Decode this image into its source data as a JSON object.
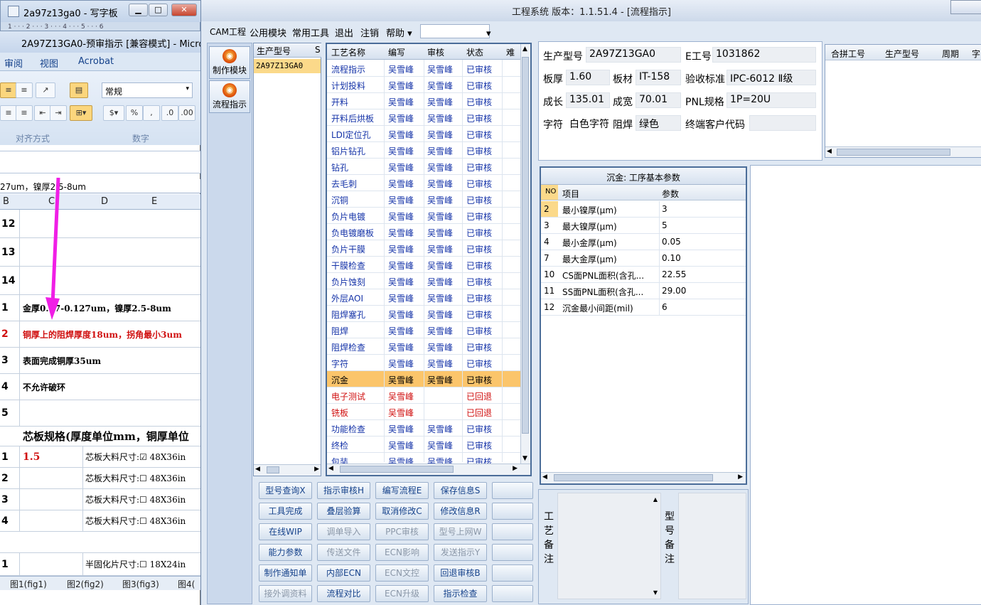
{
  "wordpad": {
    "title": "2a97z13ga0 - 写字板",
    "ruler": "1 · · · 2 · · · 3 · · · 4 · · · 5 · · · 6"
  },
  "excel": {
    "title": "2A97Z13GA0-预审指示 [兼容模式] - Microsof",
    "tabs": [
      "审阅",
      "视图",
      "Acrobat"
    ],
    "format_value": "常规",
    "group_align": "对齐方式",
    "group_number": "数字",
    "formula_text": "27um，镍厚2.5-8um",
    "col_headers": [
      "B",
      "C",
      "D",
      "E"
    ],
    "rows": [
      {
        "num": "12",
        "text": "",
        "red": false
      },
      {
        "num": "13",
        "text": "",
        "red": false
      },
      {
        "num": "14",
        "text": "",
        "red": false
      },
      {
        "num": "1",
        "text": "金厚0.07-0.127um，镍厚2.5-8um",
        "red": false
      },
      {
        "num": "2",
        "text": "铜厚上的阻焊厚度18um，拐角最小3um",
        "red": true
      },
      {
        "num": "3",
        "text": "表面完成铜厚35um",
        "red": false
      },
      {
        "num": "4",
        "text": "不允许破环",
        "red": false
      },
      {
        "num": "5",
        "text": "",
        "red": false
      }
    ],
    "core_header": "芯板规格(厚度单位mm，铜厚单位",
    "core_rows": [
      {
        "num": "1",
        "val": "1.5",
        "label": "芯板大料尺寸:☑ 48X36in"
      },
      {
        "num": "2",
        "val": "",
        "label": "芯板大料尺寸:☐ 48X36in"
      },
      {
        "num": "3",
        "val": "",
        "label": "芯板大料尺寸:☐ 48X36in"
      },
      {
        "num": "4",
        "val": "",
        "label": "芯板大料尺寸:☐ 48X36in"
      }
    ],
    "pp_row": {
      "num": "1",
      "label": "半固化片尺寸:☐ 18X24in"
    },
    "sheet_tabs": [
      "图1(fig1)",
      "图2(fig2)",
      "图3(fig3)",
      "图4("
    ]
  },
  "app": {
    "title": "工程系统  版本：1.1.51.4 - [流程指示]",
    "menu": [
      "CAM工程",
      "公用模块",
      "常用工具",
      "退出",
      "注销",
      "帮助 ▾"
    ],
    "nav": [
      {
        "label": "制作模块"
      },
      {
        "label": "流程指示"
      }
    ],
    "model_header": "生产型号",
    "model_header_more": "S",
    "model_selected": "2A97Z13GA0",
    "grid_headers": [
      "工艺名称",
      "编写",
      "审核",
      "状态",
      "难"
    ],
    "process_rows": [
      {
        "name": "流程指示",
        "writer": "吴雪峰",
        "reviewer": "吴雪峰",
        "status": "已审核",
        "state": "normal"
      },
      {
        "name": "计划投料",
        "writer": "吴雪峰",
        "reviewer": "吴雪峰",
        "status": "已审核",
        "state": "normal"
      },
      {
        "name": "开料",
        "writer": "吴雪峰",
        "reviewer": "吴雪峰",
        "status": "已审核",
        "state": "normal"
      },
      {
        "name": "开料后烘板",
        "writer": "吴雪峰",
        "reviewer": "吴雪峰",
        "status": "已审核",
        "state": "normal"
      },
      {
        "name": "LDI定位孔",
        "writer": "吴雪峰",
        "reviewer": "吴雪峰",
        "status": "已审核",
        "state": "normal"
      },
      {
        "name": "铝片钻孔",
        "writer": "吴雪峰",
        "reviewer": "吴雪峰",
        "status": "已审核",
        "state": "normal"
      },
      {
        "name": "钻孔",
        "writer": "吴雪峰",
        "reviewer": "吴雪峰",
        "status": "已审核",
        "state": "normal"
      },
      {
        "name": "去毛刺",
        "writer": "吴雪峰",
        "reviewer": "吴雪峰",
        "status": "已审核",
        "state": "normal"
      },
      {
        "name": "沉铜",
        "writer": "吴雪峰",
        "reviewer": "吴雪峰",
        "status": "已审核",
        "state": "normal"
      },
      {
        "name": "负片电镀",
        "writer": "吴雪峰",
        "reviewer": "吴雪峰",
        "status": "已审核",
        "state": "normal"
      },
      {
        "name": "负电镀磨板",
        "writer": "吴雪峰",
        "reviewer": "吴雪峰",
        "status": "已审核",
        "state": "normal"
      },
      {
        "name": "负片干膜",
        "writer": "吴雪峰",
        "reviewer": "吴雪峰",
        "status": "已审核",
        "state": "normal"
      },
      {
        "name": "干膜检查",
        "writer": "吴雪峰",
        "reviewer": "吴雪峰",
        "status": "已审核",
        "state": "normal"
      },
      {
        "name": "负片蚀刻",
        "writer": "吴雪峰",
        "reviewer": "吴雪峰",
        "status": "已审核",
        "state": "normal"
      },
      {
        "name": "外层AOI",
        "writer": "吴雪峰",
        "reviewer": "吴雪峰",
        "status": "已审核",
        "state": "normal"
      },
      {
        "name": "阻焊塞孔",
        "writer": "吴雪峰",
        "reviewer": "吴雪峰",
        "status": "已审核",
        "state": "normal"
      },
      {
        "name": "阻焊",
        "writer": "吴雪峰",
        "reviewer": "吴雪峰",
        "status": "已审核",
        "state": "normal"
      },
      {
        "name": "阻焊检查",
        "writer": "吴雪峰",
        "reviewer": "吴雪峰",
        "status": "已审核",
        "state": "normal"
      },
      {
        "name": "字符",
        "writer": "吴雪峰",
        "reviewer": "吴雪峰",
        "status": "已审核",
        "state": "normal"
      },
      {
        "name": "沉金",
        "writer": "吴雪峰",
        "reviewer": "吴雪峰",
        "status": "已审核",
        "state": "selected"
      },
      {
        "name": "电子测试",
        "writer": "吴雪峰",
        "reviewer": "",
        "status": "已回退",
        "state": "red"
      },
      {
        "name": "铣板",
        "writer": "吴雪峰",
        "reviewer": "",
        "status": "已回退",
        "state": "red"
      },
      {
        "name": "功能检查",
        "writer": "吴雪峰",
        "reviewer": "吴雪峰",
        "status": "已审核",
        "state": "normal"
      },
      {
        "name": "终检",
        "writer": "吴雪峰",
        "reviewer": "吴雪峰",
        "status": "已审核",
        "state": "normal"
      },
      {
        "name": "包装",
        "writer": "吴雪峰",
        "reviewer": "吴雪峰",
        "status": "已审核",
        "state": "normal"
      }
    ],
    "buttons": [
      [
        {
          "label": "型号查询X",
          "enabled": true
        },
        {
          "label": "指示审核H",
          "enabled": true
        },
        {
          "label": "编写流程E",
          "enabled": true
        },
        {
          "label": "保存信息S",
          "enabled": true
        },
        {
          "label": "",
          "enabled": true
        }
      ],
      [
        {
          "label": "工具完成",
          "enabled": true
        },
        {
          "label": "叠层验算",
          "enabled": true
        },
        {
          "label": "取消修改C",
          "enabled": true
        },
        {
          "label": "修改信息R",
          "enabled": true
        },
        {
          "label": "",
          "enabled": true
        }
      ],
      [
        {
          "label": "在线WIP",
          "enabled": true
        },
        {
          "label": "调单导入",
          "enabled": false
        },
        {
          "label": "PPC审核",
          "enabled": false
        },
        {
          "label": "型号上网W",
          "enabled": false
        },
        {
          "label": "",
          "enabled": true
        }
      ],
      [
        {
          "label": "能力参数",
          "enabled": true
        },
        {
          "label": "传送文件",
          "enabled": false
        },
        {
          "label": "ECN影响",
          "enabled": false
        },
        {
          "label": "发送指示Y",
          "enabled": false
        },
        {
          "label": "",
          "enabled": true
        }
      ],
      [
        {
          "label": "制作通知单",
          "enabled": true
        },
        {
          "label": "内部ECN",
          "enabled": true
        },
        {
          "label": "ECN文控",
          "enabled": false
        },
        {
          "label": "回退审核B",
          "enabled": true
        },
        {
          "label": "",
          "enabled": true
        }
      ],
      [
        {
          "label": "接外调资料",
          "enabled": false
        },
        {
          "label": "流程对比",
          "enabled": true
        },
        {
          "label": "ECN升级",
          "enabled": false
        },
        {
          "label": "指示检查",
          "enabled": true
        },
        {
          "label": "",
          "enabled": true
        }
      ]
    ],
    "info": {
      "model_label": "生产型号",
      "model_value": "2A97Z13GA0",
      "e_label": "E工号",
      "e_value": "1031862",
      "thickness_label": "板厚",
      "thickness_value": "1.60",
      "material_label": "板材",
      "material_value": "IT-158",
      "standard_label": "验收标准",
      "standard_value": "IPC-6012 Ⅱ级",
      "length_label": "成长",
      "length_value": "135.01",
      "width_label": "成宽",
      "width_value": "70.01",
      "pnl_label": "PNL规格",
      "pnl_value": "1P=20U",
      "char_label": "字符",
      "char_value": "白色字符",
      "mask_label": "阻焊",
      "mask_value": "绿色",
      "customer_label": "终端客户代码",
      "customer_value": ""
    },
    "merge_headers": [
      "合拼工号",
      "生产型号",
      "周期",
      "字"
    ],
    "params": {
      "title": "沉金: 工序基本参数",
      "headers": [
        "NO",
        "项目",
        "参数"
      ],
      "rows": [
        {
          "no": "2",
          "item": "最小镍厚(μm)",
          "value": "3"
        },
        {
          "no": "3",
          "item": "最大镍厚(μm)",
          "value": "5"
        },
        {
          "no": "4",
          "item": "最小金厚(μm)",
          "value": "0.05"
        },
        {
          "no": "7",
          "item": "最大金厚(μm)",
          "value": "0.10"
        },
        {
          "no": "10",
          "item": "CS面PNL面积(含孔...",
          "value": "22.55"
        },
        {
          "no": "11",
          "item": "SS面PNL面积(含孔...",
          "value": "29.00"
        },
        {
          "no": "12",
          "item": "沉金最小间距(mil)",
          "value": "6"
        }
      ]
    },
    "notes": {
      "process_label": "工艺备注",
      "model_label": "型号备注"
    }
  }
}
